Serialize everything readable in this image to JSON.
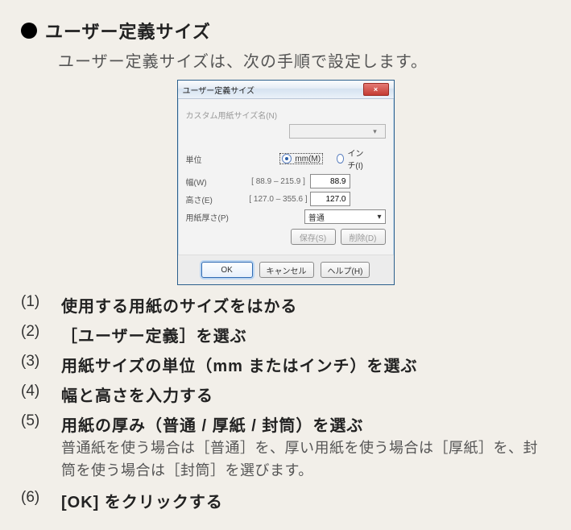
{
  "heading": {
    "title": "ユーザー定義サイズ",
    "lead": "ユーザー定義サイズは、次の手順で設定します。"
  },
  "dialog": {
    "title": "ユーザー定義サイズ",
    "close_x": "×",
    "size_name_label": "カスタム用紙サイズ名(N)",
    "unit_label": "単位",
    "unit_mm": "mm(M)",
    "unit_inch": "インチ(I)",
    "width_label": "幅(W)",
    "width_hint": "[ 88.9 – 215.9 ]",
    "width_value": "88.9",
    "height_label": "高さ(E)",
    "height_hint": "[ 127.0 – 355.6 ]",
    "height_value": "127.0",
    "thickness_label": "用紙厚さ(P)",
    "thickness_value": "普通",
    "save_label": "保存(S)",
    "delete_label": "削除(D)",
    "ok_label": "OK",
    "cancel_label": "キャンセル",
    "help_label": "ヘルプ(H)"
  },
  "steps": [
    {
      "num": "(1)",
      "title": "使用する用紙のサイズをはかる"
    },
    {
      "num": "(2)",
      "title": "［ユーザー定義］を選ぶ"
    },
    {
      "num": "(3)",
      "title": "用紙サイズの単位（mm またはインチ）を選ぶ"
    },
    {
      "num": "(4)",
      "title": "幅と高さを入力する"
    },
    {
      "num": "(5)",
      "title": "用紙の厚み（普通 / 厚紙 / 封筒）を選ぶ",
      "desc": "普通紙を使う場合は［普通］を、厚い用紙を使う場合は［厚紙］を、封筒を使う場合は［封筒］を選びます。"
    },
    {
      "num": "(6)",
      "title": "[OK] をクリックする"
    }
  ]
}
